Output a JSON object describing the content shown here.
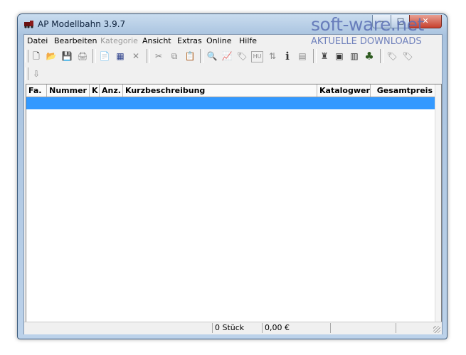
{
  "window": {
    "title": "AP Modellbahn 3.9.7",
    "caption": {
      "minimize": "–",
      "maximize": "□",
      "close": "✕"
    }
  },
  "menu": [
    {
      "label": "Datei",
      "enabled": true
    },
    {
      "label": "Bearbeiten",
      "enabled": true
    },
    {
      "label": "Kategorie",
      "enabled": false
    },
    {
      "label": "Ansicht",
      "enabled": true
    },
    {
      "label": "Extras",
      "enabled": true
    },
    {
      "label": "Online",
      "enabled": true
    },
    {
      "label": "Hilfe",
      "enabled": true
    }
  ],
  "toolbar": {
    "icons": {
      "new": "🗋",
      "open": "📂",
      "save": "💾",
      "print": "🖨",
      "copy_item": "📄",
      "grid": "▦",
      "delete": "✕",
      "cut": "✂",
      "copy": "⧉",
      "paste": "📋",
      "find": "🔍",
      "graph": "📈",
      "tag": "🏷",
      "hu": "HU",
      "sort": "⇅",
      "info": "ℹ",
      "calc": "▤",
      "figure": "♜",
      "loco": "▣",
      "wagon": "▥",
      "tree": "♣",
      "label_tool": "🏷",
      "label_tool2": "🏷",
      "sort_list": "⇩"
    }
  },
  "table": {
    "columns": [
      "Fa.",
      "Nummer",
      "K",
      "Anz.",
      "Kurzbeschreibung",
      "Katalogwert",
      "Gesamtpreis"
    ]
  },
  "status": {
    "count": "0 Stück",
    "total": "0,00 €"
  },
  "watermark": {
    "brand": "soft-ware.net",
    "tagline": "AKTUELLE DOWNLOADS"
  },
  "colors": {
    "selection": "#3399ff",
    "watermark": "#5a6fb4"
  }
}
